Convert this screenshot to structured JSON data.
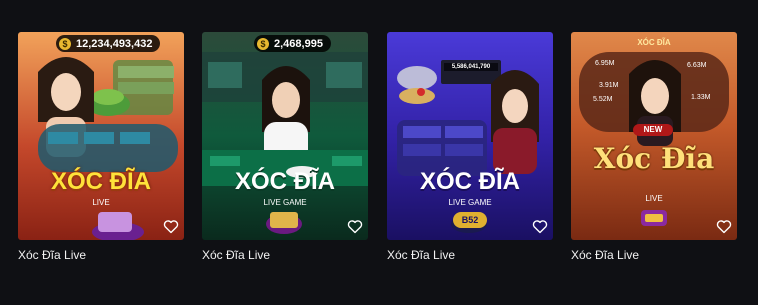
{
  "games": [
    {
      "caption": "Xóc Đĩa Live",
      "jackpot": "12,234,493,432",
      "title": "XÓC ĐĨA",
      "subtitle": "LIVE"
    },
    {
      "caption": "Xóc Đĩa Live",
      "jackpot": "2,468,995",
      "title": "XÓC ĐĨA",
      "subtitle": "LIVE GAME"
    },
    {
      "caption": "Xóc Đĩa Live",
      "screen_value": "5,586,041,790",
      "title": "XÓC ĐĨA",
      "subtitle": "LIVE GAME",
      "logo": "B52"
    },
    {
      "caption": "Xóc Đĩa Live",
      "title_top": "XÓC ĐĨA",
      "badge": "NEW",
      "title": "Xóc Đĩa",
      "subtitle": "LIVE",
      "board_values": [
        "6.95M",
        "3.91M",
        "5.52M",
        "6.63M",
        "1.33M"
      ]
    }
  ],
  "icons": {
    "favorite": "heart-outline-icon",
    "currency": "dollar-coin-icon"
  },
  "colors": {
    "page_bg": "#0f1014",
    "caption_text": "#f2f2f2",
    "title_yellow": "#ffe23a"
  }
}
